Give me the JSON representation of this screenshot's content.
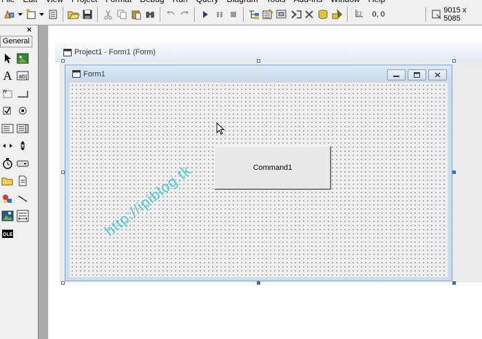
{
  "menu": {
    "items": [
      "File",
      "Edit",
      "View",
      "Project",
      "Format",
      "Debug",
      "Run",
      "Query",
      "Diagram",
      "Tools",
      "Add-Ins",
      "Window",
      "Help"
    ]
  },
  "toolbar": {
    "position_readout": "0, 0",
    "size_readout": "9015 x 5085"
  },
  "toolbox": {
    "tab_label": "General",
    "close_glyph": "×",
    "tools": [
      "pointer-icon",
      "picturebox-icon",
      "label-icon",
      "textbox-icon",
      "frame-icon",
      "commandbutton-icon",
      "checkbox-icon",
      "optionbutton-icon",
      "combobox-icon",
      "listbox-icon",
      "hscrollbar-icon",
      "vscrollbar-icon",
      "timer-icon",
      "drivelistbox-icon",
      "dirlistbox-icon",
      "filelistbox-icon",
      "shape-icon",
      "line-icon",
      "image-icon",
      "data-icon",
      "ole-icon"
    ]
  },
  "project_window": {
    "title": "Project1 - Form1 (Form)"
  },
  "form": {
    "title": "Form1",
    "command_button_caption": "Command1"
  },
  "watermark": "http://ipiblog.tk",
  "colors": {
    "accent_handles": "#2a6fc9",
    "watermark": "#29c6d6"
  }
}
